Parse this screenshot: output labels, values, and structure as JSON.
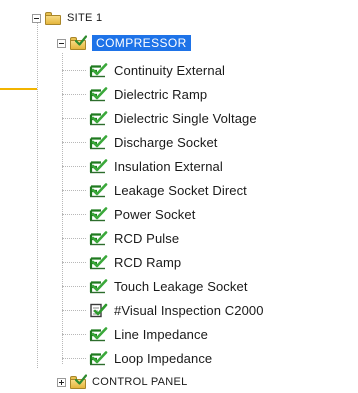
{
  "tree": {
    "site": {
      "label": "SITE 1",
      "expanded": true
    },
    "compressor": {
      "label": "COMPRESSOR",
      "expanded": true,
      "selected": true
    },
    "tests": [
      {
        "label": "Continuity External",
        "icon": "checked-test-icon"
      },
      {
        "label": "Dielectric Ramp",
        "icon": "checked-test-icon"
      },
      {
        "label": "Dielectric Single Voltage",
        "icon": "checked-test-icon"
      },
      {
        "label": "Discharge Socket",
        "icon": "checked-test-icon"
      },
      {
        "label": "Insulation External",
        "icon": "checked-test-icon"
      },
      {
        "label": "Leakage Socket Direct",
        "icon": "checked-test-icon"
      },
      {
        "label": "Power Socket",
        "icon": "checked-test-icon"
      },
      {
        "label": "RCD Pulse",
        "icon": "checked-test-icon"
      },
      {
        "label": "RCD Ramp",
        "icon": "checked-test-icon"
      },
      {
        "label": "Touch Leakage Socket",
        "icon": "checked-test-icon"
      },
      {
        "label": "#Visual Inspection C2000",
        "icon": "visual-inspection-icon"
      },
      {
        "label": "Line Impedance",
        "icon": "checked-test-icon"
      },
      {
        "label": "Loop Impedance",
        "icon": "checked-test-icon"
      }
    ],
    "control_panel": {
      "label": "CONTROL PANEL",
      "expanded": false
    }
  },
  "colors": {
    "selection": "#1e73e8",
    "accent_line": "#f2b400",
    "check_green": "#2e8b2e",
    "folder_yellow": "#f0c850"
  }
}
